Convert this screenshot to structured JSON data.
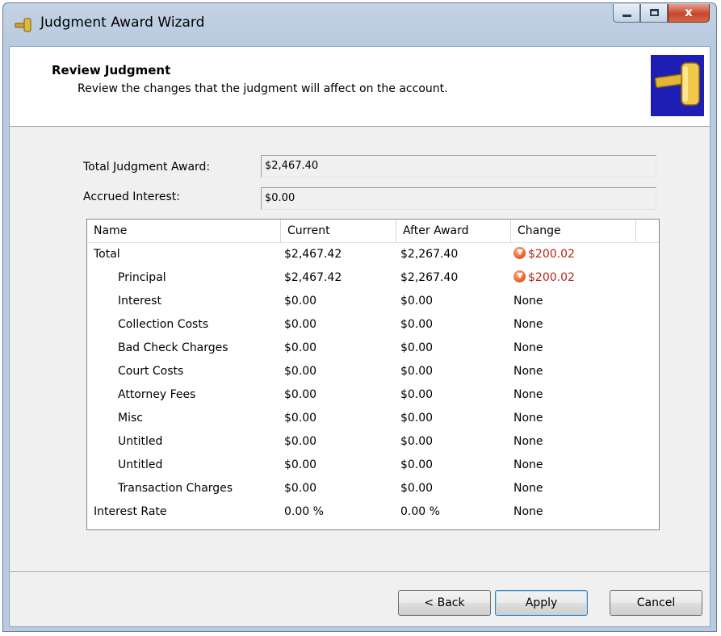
{
  "window": {
    "title": "Judgment Award Wizard",
    "close_glyph": "x"
  },
  "header": {
    "title": "Review Judgment",
    "description": "Review the changes that the judgment will affect on the account."
  },
  "fields": {
    "total_award_label": "Total Judgment Award:",
    "total_award_value": "$2,467.40",
    "accrued_interest_label": "Accrued Interest:",
    "accrued_interest_value": "$0.00"
  },
  "grid": {
    "columns": [
      "Name",
      "Current",
      "After Award",
      "Change"
    ],
    "rows": [
      {
        "name": "Total",
        "current": "$2,467.42",
        "after": "$2,267.40",
        "change": "$200.02"
      },
      {
        "name": "Principal",
        "current": "$2,467.42",
        "after": "$2,267.40",
        "change": "$200.02"
      },
      {
        "name": "Interest",
        "current": "$0.00",
        "after": "$0.00",
        "change": "None"
      },
      {
        "name": "Collection Costs",
        "current": "$0.00",
        "after": "$0.00",
        "change": "None"
      },
      {
        "name": "Bad Check Charges",
        "current": "$0.00",
        "after": "$0.00",
        "change": "None"
      },
      {
        "name": "Court Costs",
        "current": "$0.00",
        "after": "$0.00",
        "change": "None"
      },
      {
        "name": "Attorney Fees",
        "current": "$0.00",
        "after": "$0.00",
        "change": "None"
      },
      {
        "name": "Misc",
        "current": "$0.00",
        "after": "$0.00",
        "change": "None"
      },
      {
        "name": "Untitled",
        "current": "$0.00",
        "after": "$0.00",
        "change": "None"
      },
      {
        "name": "Untitled",
        "current": "$0.00",
        "after": "$0.00",
        "change": "None"
      },
      {
        "name": "Transaction Charges",
        "current": "$0.00",
        "after": "$0.00",
        "change": "None"
      },
      {
        "name": "Interest Rate",
        "current": "0.00 %",
        "after": "0.00 %",
        "change": "None"
      }
    ]
  },
  "buttons": {
    "back": "< Back",
    "apply": "Apply",
    "cancel": "Cancel"
  },
  "colors": {
    "decrease_text": "#b8231c",
    "header_icon_bg": "#1e1eb4"
  },
  "icons": {
    "title": "gavel-icon",
    "header": "gavel-icon",
    "change_decrease": "down-arrow-circle-icon"
  }
}
